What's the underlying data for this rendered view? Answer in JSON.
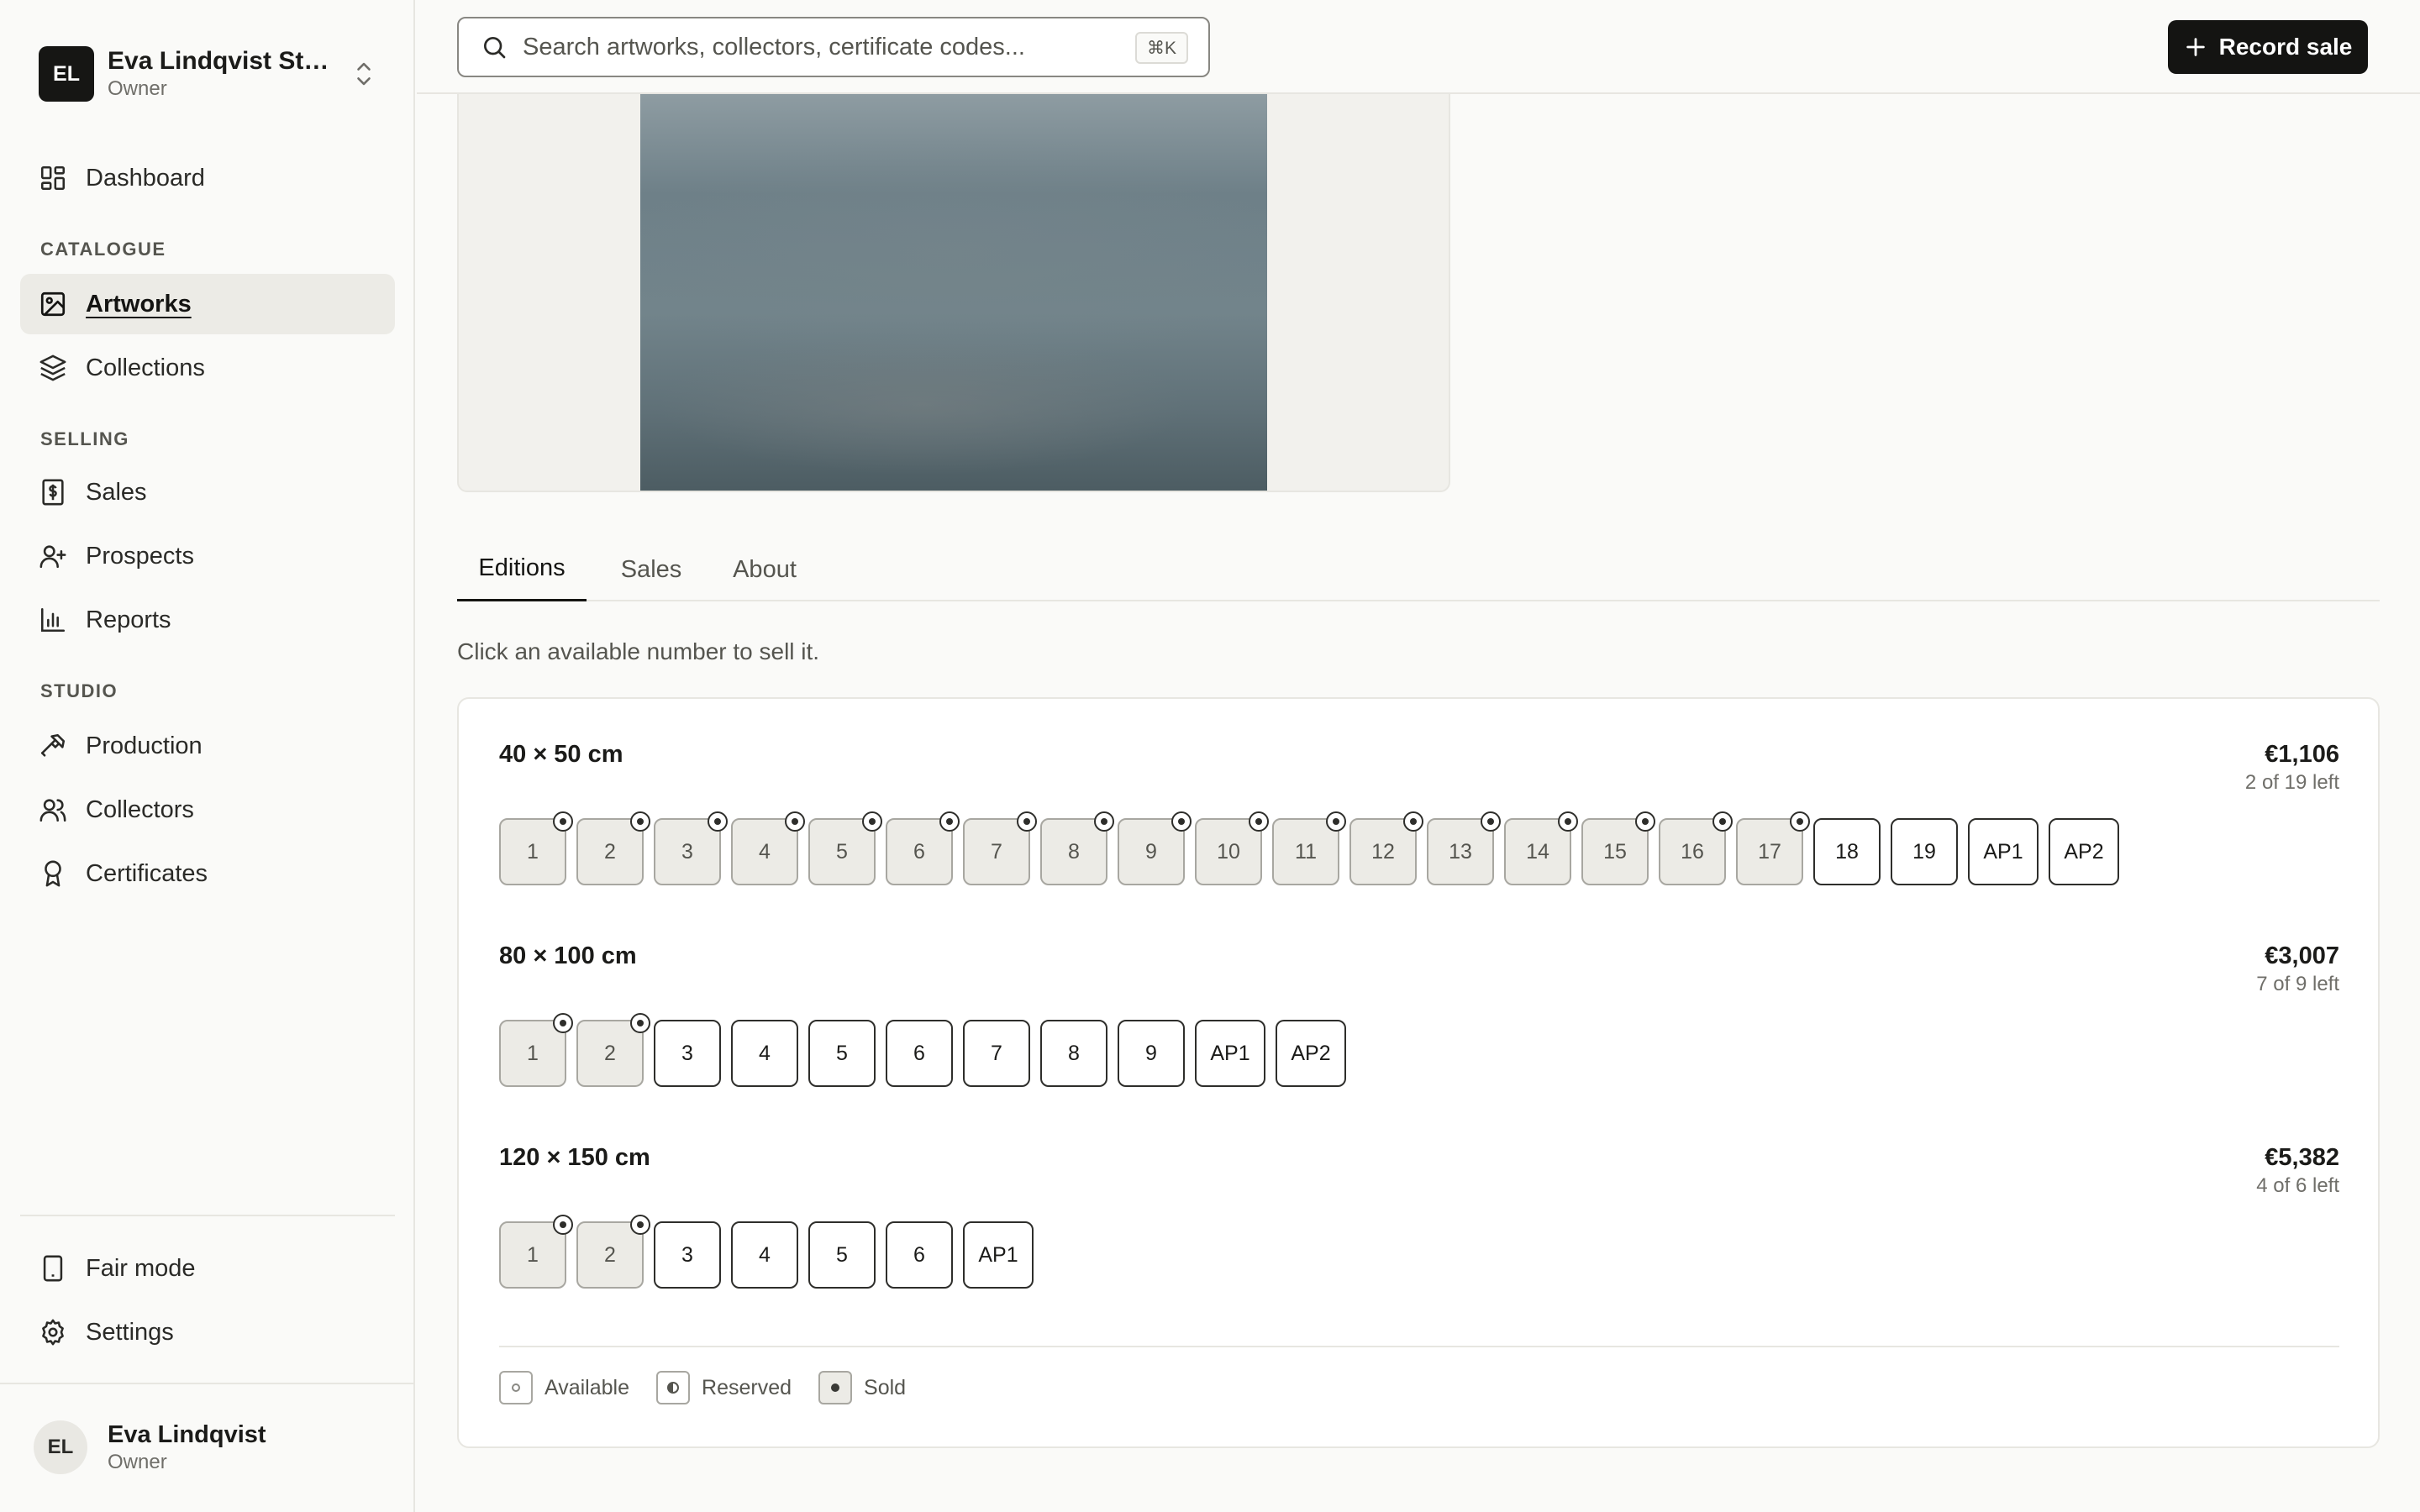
{
  "workspace": {
    "initials": "EL",
    "name": "Eva Lindqvist Stu...",
    "role": "Owner"
  },
  "nav": {
    "dashboard": "Dashboard",
    "section_catalogue": "CATALOGUE",
    "artworks": "Artworks",
    "collections": "Collections",
    "section_selling": "SELLING",
    "sales": "Sales",
    "prospects": "Prospects",
    "reports": "Reports",
    "section_studio": "STUDIO",
    "production": "Production",
    "collectors": "Collectors",
    "certificates": "Certificates",
    "fair_mode": "Fair mode",
    "settings": "Settings"
  },
  "user": {
    "initials": "EL",
    "name": "Eva Lindqvist",
    "role": "Owner"
  },
  "search": {
    "placeholder": "Search artworks, collectors, certificate codes...",
    "shortcut": "⌘K"
  },
  "header": {
    "record_sale": "Record sale"
  },
  "tabs": {
    "editions": "Editions",
    "sales": "Sales",
    "about": "About",
    "active": "editions"
  },
  "hint": "Click an available number to sell it.",
  "sizes": [
    {
      "title": "40 × 50 cm",
      "price": "€1,106",
      "left": "2 of 19 left",
      "numbers": [
        {
          "label": "1",
          "status": "sold"
        },
        {
          "label": "2",
          "status": "sold"
        },
        {
          "label": "3",
          "status": "sold"
        },
        {
          "label": "4",
          "status": "sold"
        },
        {
          "label": "5",
          "status": "sold"
        },
        {
          "label": "6",
          "status": "sold"
        },
        {
          "label": "7",
          "status": "sold"
        },
        {
          "label": "8",
          "status": "sold"
        },
        {
          "label": "9",
          "status": "sold"
        },
        {
          "label": "10",
          "status": "sold"
        },
        {
          "label": "11",
          "status": "sold"
        },
        {
          "label": "12",
          "status": "sold"
        },
        {
          "label": "13",
          "status": "sold"
        },
        {
          "label": "14",
          "status": "sold"
        },
        {
          "label": "15",
          "status": "sold"
        },
        {
          "label": "16",
          "status": "sold"
        },
        {
          "label": "17",
          "status": "sold"
        },
        {
          "label": "18",
          "status": "available"
        },
        {
          "label": "19",
          "status": "available"
        },
        {
          "label": "AP1",
          "status": "available"
        },
        {
          "label": "AP2",
          "status": "available"
        }
      ]
    },
    {
      "title": "80 × 100 cm",
      "price": "€3,007",
      "left": "7 of 9 left",
      "numbers": [
        {
          "label": "1",
          "status": "sold"
        },
        {
          "label": "2",
          "status": "sold"
        },
        {
          "label": "3",
          "status": "available"
        },
        {
          "label": "4",
          "status": "available"
        },
        {
          "label": "5",
          "status": "available"
        },
        {
          "label": "6",
          "status": "available"
        },
        {
          "label": "7",
          "status": "available"
        },
        {
          "label": "8",
          "status": "available"
        },
        {
          "label": "9",
          "status": "available"
        },
        {
          "label": "AP1",
          "status": "available"
        },
        {
          "label": "AP2",
          "status": "available"
        }
      ]
    },
    {
      "title": "120 × 150 cm",
      "price": "€5,382",
      "left": "4 of 6 left",
      "numbers": [
        {
          "label": "1",
          "status": "sold"
        },
        {
          "label": "2",
          "status": "sold"
        },
        {
          "label": "3",
          "status": "available"
        },
        {
          "label": "4",
          "status": "available"
        },
        {
          "label": "5",
          "status": "available"
        },
        {
          "label": "6",
          "status": "available"
        },
        {
          "label": "AP1",
          "status": "available"
        }
      ]
    }
  ],
  "legend": {
    "available": "Available",
    "reserved": "Reserved",
    "sold": "Sold"
  },
  "colors": {
    "accent": "#141412",
    "sold_fill": "#ecebe6",
    "background": "#fafaf8"
  }
}
